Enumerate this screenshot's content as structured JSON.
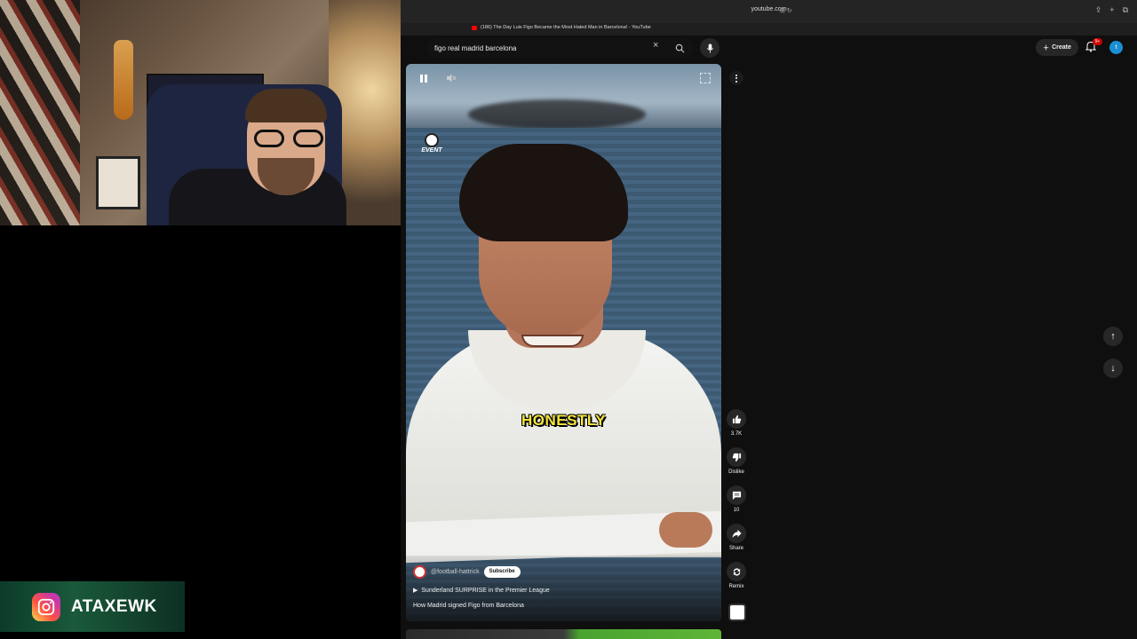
{
  "overlay": {
    "instagram_handle": "ATAXEWK"
  },
  "browser": {
    "url": "youtube.com",
    "tab_title": "(186) The Day Luis Figo Became the Most Hated Man in Barcelona! - YouTube"
  },
  "header": {
    "search_value": "figo real madrid barcelona",
    "create_label": "Create",
    "notification_count": "9+",
    "avatar_letter": "t"
  },
  "video": {
    "caption": "HONESTLY",
    "channel": "@football-hattrick",
    "subscribe_label": "Subscribe",
    "playlist_label": "Sunderland SURPRISE in the Premier League",
    "title": "How Madrid signed Figo from Barcelona",
    "event_logo_text": "EVENT"
  },
  "actions": {
    "like_count": "3.7K",
    "dislike_label": "Dislike",
    "comment_count": "10",
    "share_label": "Share",
    "remix_label": "Remix"
  },
  "colors": {
    "accent_red": "#ff0000",
    "caption_yellow": "#f5e63a",
    "avatar_blue": "#1a8fd4"
  }
}
